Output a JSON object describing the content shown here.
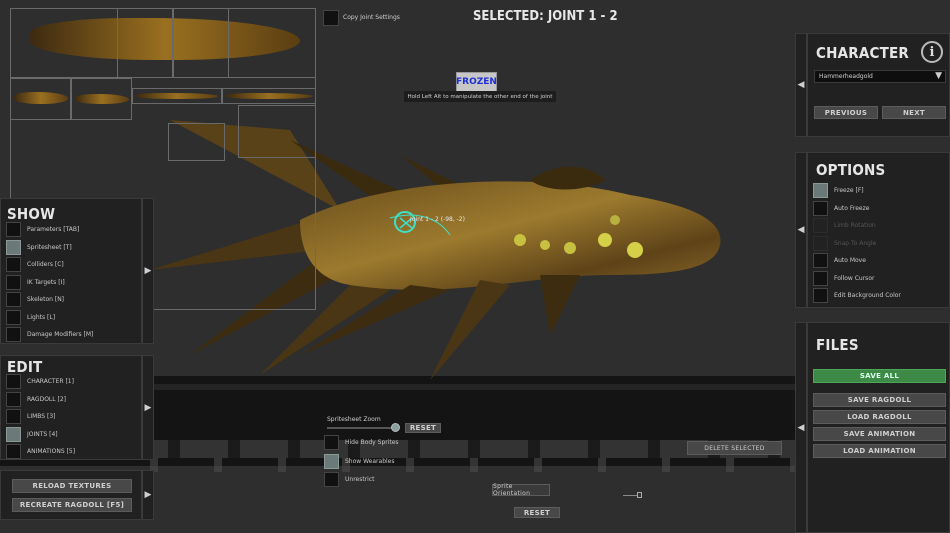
{
  "header": {
    "selected_title": "SELECTED: JOINT 1 - 2",
    "frozen_badge": "FROZEN",
    "hint": "Hold Left Alt to manipulate the other end of the joint",
    "copy_joint_label": "Copy Joint Settings"
  },
  "joint_label": "Joint 1 - 2 (-98, -2)",
  "show_panel": {
    "title": "SHOW",
    "items": [
      {
        "label": "Parameters [TAB]",
        "checked": false
      },
      {
        "label": "Spritesheet [T]",
        "checked": true
      },
      {
        "label": "Colliders [C]",
        "checked": false
      },
      {
        "label": "IK Targets [I]",
        "checked": false
      },
      {
        "label": "Skeleton [N]",
        "checked": false
      },
      {
        "label": "Lights [L]",
        "checked": false
      },
      {
        "label": "Damage Modifiers [M]",
        "checked": false
      }
    ]
  },
  "edit_panel": {
    "title": "EDIT",
    "items": [
      {
        "label": "CHARACTER [1]",
        "checked": false
      },
      {
        "label": "RAGDOLL [2]",
        "checked": false
      },
      {
        "label": "LIMBS [3]",
        "checked": false
      },
      {
        "label": "JOINTS [4]",
        "checked": true
      },
      {
        "label": "ANIMATIONS [5]",
        "checked": false
      }
    ]
  },
  "reload_panel": {
    "reload_label": "RELOAD TEXTURES",
    "recreate_label": "RECREATE RAGDOLL [F5]"
  },
  "character_panel": {
    "title": "CHARACTER",
    "info_icon_text": "i",
    "dropdown_value": "Hammerheadgold",
    "previous_label": "PREVIOUS",
    "next_label": "NEXT"
  },
  "options_panel": {
    "title": "OPTIONS",
    "items": [
      {
        "label": "Freeze [F]",
        "checked": true,
        "dim": false
      },
      {
        "label": "Auto Freeze",
        "checked": false,
        "dim": false
      },
      {
        "label": "Limb Rotation",
        "checked": false,
        "dim": true
      },
      {
        "label": "Snap To Angle",
        "checked": false,
        "dim": true
      },
      {
        "label": "Auto Move",
        "checked": false,
        "dim": false
      },
      {
        "label": "Follow Cursor",
        "checked": false,
        "dim": false
      },
      {
        "label": "Edit Background Color",
        "checked": false,
        "dim": false
      }
    ]
  },
  "files_panel": {
    "title": "FILES",
    "save_all": "SAVE ALL",
    "save_ragdoll": "SAVE RAGDOLL",
    "load_ragdoll": "LOAD RAGDOLL",
    "save_animation": "SAVE ANIMATION",
    "load_animation": "LOAD ANIMATION"
  },
  "spritesheet_controls": {
    "zoom_label": "Spritesheet Zoom",
    "reset_label": "RESET",
    "hide_body_sprites": "Hide Body Sprites",
    "show_wearables": "Show Wearables",
    "unrestrict": "Unrestrict",
    "sprite_orientation": "Sprite Orientation",
    "reset_bottom": "RESET",
    "delete_selected": "DELETE SELECTED"
  },
  "colors": {
    "panel_bg": "#212121",
    "accent_green": "#3d8a47",
    "frozen_blue": "#1e2fd6",
    "joint_cyan": "#3fe0c8"
  }
}
